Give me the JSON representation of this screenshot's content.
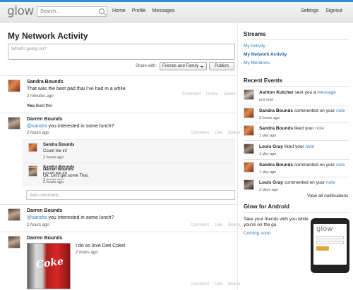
{
  "header": {
    "logo": "glow",
    "search_placeholder": "Search...",
    "nav_left": [
      "Home",
      "Profile",
      "Messages"
    ],
    "nav_right": [
      "Settings",
      "Signout"
    ]
  },
  "main": {
    "title": "My Network Activity",
    "status_placeholder": "What's going on?",
    "share_label": "Share with:",
    "share_value": "Friends and Family",
    "publish_label": "Publish",
    "comment_placeholder": "Add comment...",
    "posts": [
      {
        "author": "Sandra Bounds",
        "text": "That was the best pad thai I've had in a while.",
        "time": "2 minutes ago",
        "actions": [
          "Comment",
          "Unlike",
          "Delete"
        ],
        "liked_prefix": "You",
        "liked_suffix": "liked this"
      },
      {
        "author": "Darren Bounds",
        "mention": "@sandra",
        "text": " you interested in some lunch?",
        "time": "2 hours ago",
        "actions": [
          "Comment",
          "Like",
          "Delete"
        ],
        "replies": [
          {
            "author": "Sandra Bounds",
            "text": "Count me in!",
            "time": "2 hours ago"
          },
          {
            "author": "Darren Bounds",
            "text": "Ok. Let's get some Thai.",
            "time": "2 hours ago"
          }
        ]
      },
      {
        "author": "Darren Bounds",
        "mention": "@sandra",
        "text": " you interested in some lunch?",
        "time": "2 hours ago",
        "actions": [
          "Comment",
          "Like",
          "Delete"
        ]
      },
      {
        "author": "Darren Bounds",
        "text": "I do so love Diet Coke!",
        "time": "2 hours ago",
        "image_text": "Coke",
        "actions": [
          "Comment",
          "Like",
          "Delete"
        ]
      }
    ]
  },
  "sidebar": {
    "streams_title": "Streams",
    "streams": [
      "My Activity",
      "My Network Activity",
      "My Mentions"
    ],
    "events_title": "Recent Events",
    "events": [
      {
        "who": "Ashton Kutcher",
        "what": " sent you a ",
        "link": "message",
        "time": "just now"
      },
      {
        "who": "Sandra Bounds",
        "what": " commented on your ",
        "link": "note",
        "time": "2 hours ago"
      },
      {
        "who": "Sandra Bounds",
        "what": " liked your ",
        "link": "note",
        "time": "1 day ago"
      },
      {
        "who": "Louis Gray",
        "what": " liked your ",
        "link": "note",
        "time": "1 day ago"
      },
      {
        "who": "Sandra Bounds",
        "what": " commented on your ",
        "link": "note",
        "time": "1 day ago"
      },
      {
        "who": "Louis Gray",
        "what": " commented on your ",
        "link": "note",
        "time": "2 days ago"
      }
    ],
    "view_all": "View all notifications",
    "android_title": "Glow for Android",
    "android_text_1": "Take your friends with you while",
    "android_text_2": "you're on the go.",
    "coming_soon": "Coming soon",
    "phone_logo": "glow"
  }
}
